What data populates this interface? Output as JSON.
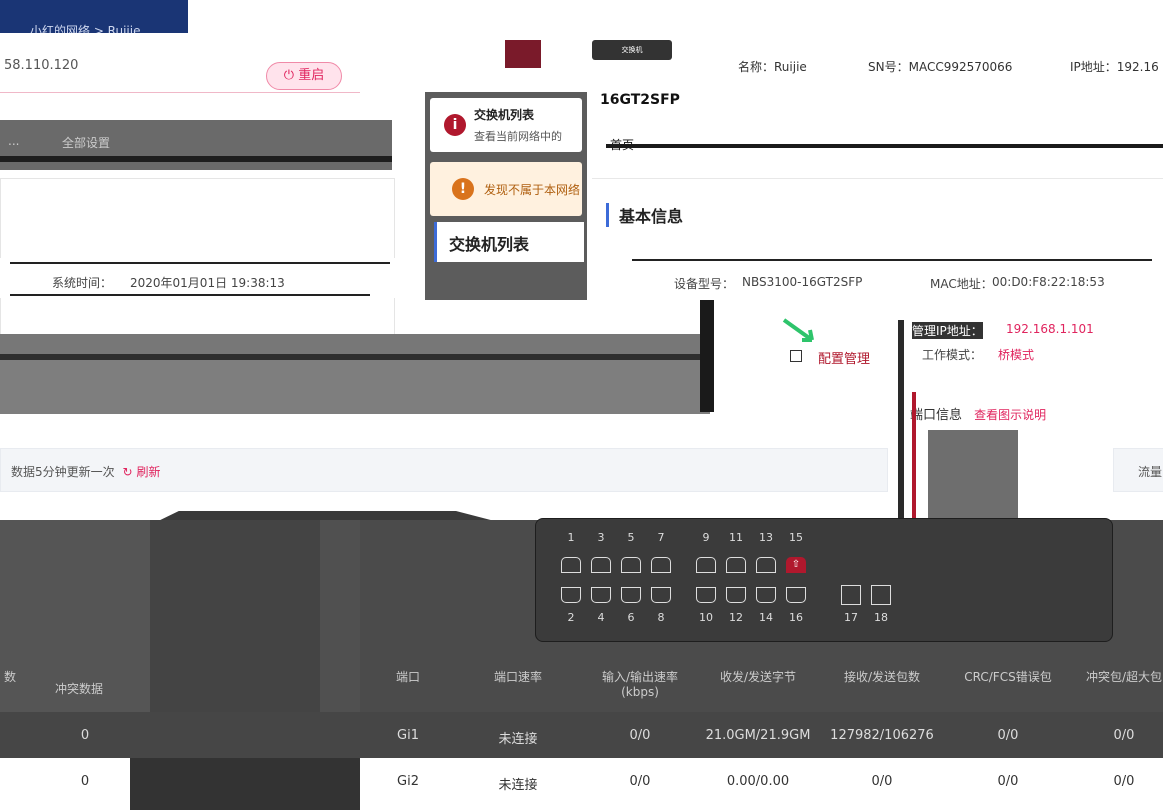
{
  "breadcrumb": "小红的网络 > Ruijie",
  "left_ip": "58.110.120",
  "reboot_label": "重启",
  "left_nav": {
    "item1": "...",
    "item2": "全部设置"
  },
  "system_time_label": "系统时间：",
  "system_time_value": "2020年01月01日 19:38:13",
  "refresh": {
    "text": "数据5分钟更新一次",
    "link": "刷新"
  },
  "traffic_label": "流量",
  "mid": {
    "card1_title": "交换机列表",
    "card1_desc": "查看当前网络中的",
    "card2_text": "发现不属于本网络",
    "section_title": "交换机列表"
  },
  "device": {
    "icon_text": "交换机",
    "model": "16GT2SFP",
    "name": "名称：Ruijie",
    "sn": "SN号：MACC992570066",
    "ip": "IP地址：192.16"
  },
  "top_nav": {
    "home": "首页"
  },
  "basic_info": {
    "title": "基本信息",
    "device_model_label": "设备型号：",
    "device_model_value": "NBS3100-16GT2SFP",
    "mac_label": "MAC地址：",
    "mac_value": "00:D0:F8:22:18:53",
    "mgmt_ip_label": "管理IP地址：",
    "mgmt_ip_value": "192.168.1.101",
    "work_mode_label": "工作模式：",
    "work_mode_value": "桥模式"
  },
  "config_label": "配置管理",
  "port_info": {
    "label": "端口信息",
    "link": "查看图示说明"
  },
  "ports_top": [
    "1",
    "3",
    "5",
    "7",
    "9",
    "11",
    "13",
    "15"
  ],
  "ports_bottom": [
    "2",
    "4",
    "6",
    "8",
    "10",
    "12",
    "14",
    "16"
  ],
  "ports_sfp": [
    "17",
    "18"
  ],
  "table_left": {
    "col1": "数",
    "col2": "冲突数据",
    "row1": "0",
    "row2": "0"
  },
  "table_right": {
    "headers": [
      "端口",
      "端口速率",
      "输入/输出速率(kbps)",
      "收发/发送字节",
      "接收/发送包数",
      "CRC/FCS错误包",
      "冲突包/超大包"
    ],
    "rows": [
      [
        "Gi1",
        "未连接",
        "0/0",
        "21.0GM/21.9GM",
        "127982/106276",
        "0/0",
        "0/0"
      ],
      [
        "Gi2",
        "未连接",
        "0/0",
        "0.00/0.00",
        "0/0",
        "0/0",
        "0/0"
      ]
    ]
  },
  "colors": {
    "brand_blue": "#1a3575",
    "accent_red": "#e0245e",
    "alert_red": "#b0182d"
  }
}
